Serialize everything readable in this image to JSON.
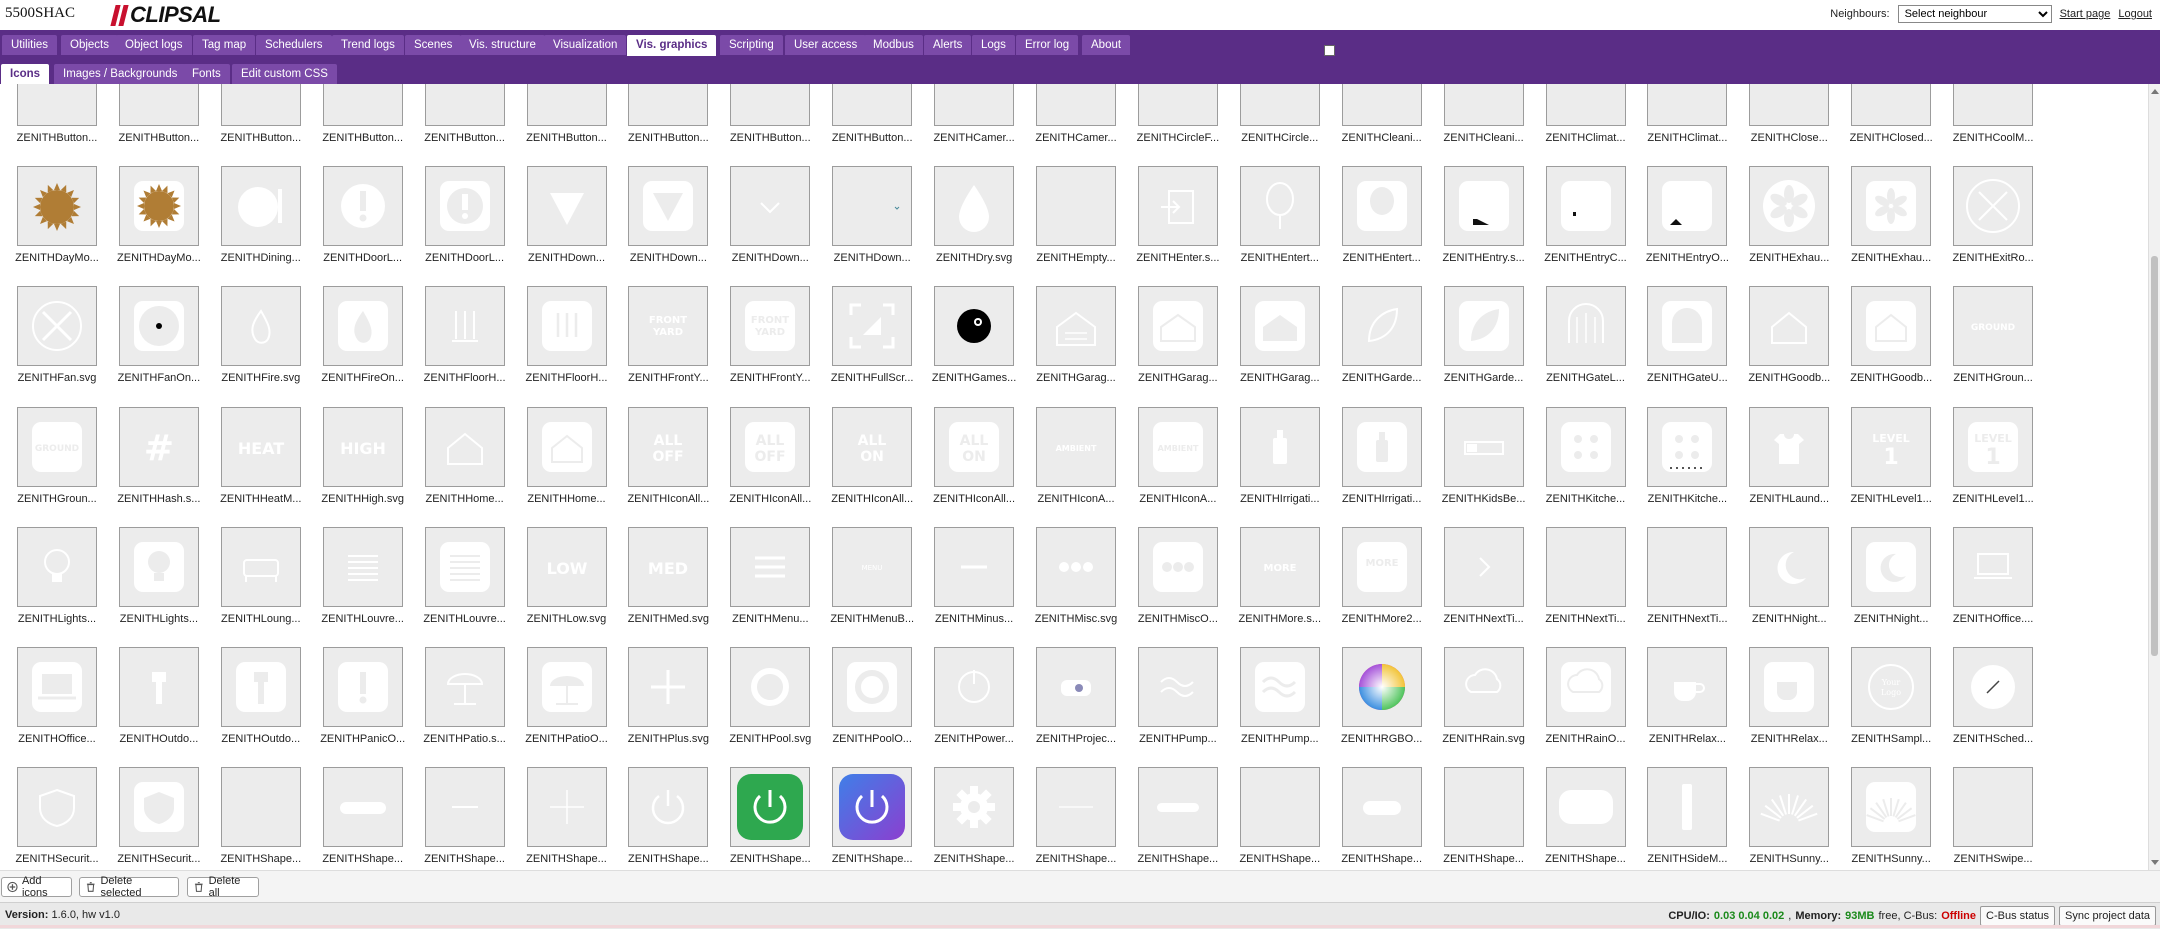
{
  "header": {
    "device_name": "5500SHAC",
    "logo_text": "CLIPSAL",
    "neighbours_label": "Neighbours:",
    "neighbour_select_value": "Select neighbour",
    "start_page_link": "Start page",
    "logout_link": "Logout"
  },
  "main_nav": [
    "Utilities",
    "Objects",
    "Object logs",
    "Tag map",
    "Schedulers",
    "Trend logs",
    "Scenes",
    "Vis. structure",
    "Visualization",
    "Vis. graphics",
    "Scripting",
    "User access",
    "Modbus",
    "Alerts",
    "Logs",
    "Error log",
    "About"
  ],
  "main_nav_active": "Vis. graphics",
  "sub_nav": [
    "Icons",
    "Images / Backgrounds",
    "Fonts",
    "Edit custom CSS"
  ],
  "sub_nav_active": "Icons",
  "icons": [
    {
      "label": "ZENITHButton...",
      "icon": "blank"
    },
    {
      "label": "ZENITHButton...",
      "icon": "green-toggle-partial"
    },
    {
      "label": "ZENITHButton...",
      "icon": "blank"
    },
    {
      "label": "ZENITHButton...",
      "icon": "blank"
    },
    {
      "label": "ZENITHButton...",
      "icon": "blank"
    },
    {
      "label": "ZENITHButton...",
      "icon": "blank"
    },
    {
      "label": "ZENITHButton...",
      "icon": "blank"
    },
    {
      "label": "ZENITHButton...",
      "icon": "blank"
    },
    {
      "label": "ZENITHButton...",
      "icon": "blank"
    },
    {
      "label": "ZENITHCamer...",
      "icon": "camera-dot"
    },
    {
      "label": "ZENITHCamer...",
      "icon": "camera-dot"
    },
    {
      "label": "ZENITHCircleF...",
      "icon": "circle-filled"
    },
    {
      "label": "ZENITHCircle...",
      "icon": "circle-outline"
    },
    {
      "label": "ZENITHCleani...",
      "icon": "cleaning-blue"
    },
    {
      "label": "ZENITHCleani...",
      "icon": "cleaning-blue-tile"
    },
    {
      "label": "ZENITHClimat...",
      "icon": "climate"
    },
    {
      "label": "ZENITHClimat...",
      "icon": "climate-tile"
    },
    {
      "label": "ZENITHClose...",
      "icon": "faint-text"
    },
    {
      "label": "ZENITHClosed...",
      "icon": "faint-text"
    },
    {
      "label": "ZENITHCoolM...",
      "icon": "faint-text"
    },
    {
      "label": "ZENITHDayMo...",
      "icon": "sun-brown"
    },
    {
      "label": "ZENITHDayMo...",
      "icon": "sun-brown-tile"
    },
    {
      "label": "ZENITHDining...",
      "icon": "dining"
    },
    {
      "label": "ZENITHDoorL...",
      "icon": "exclaim-circle"
    },
    {
      "label": "ZENITHDoorL...",
      "icon": "exclaim-circle-tile"
    },
    {
      "label": "ZENITHDown...",
      "icon": "down-triangle"
    },
    {
      "label": "ZENITHDown...",
      "icon": "down-triangle-tile"
    },
    {
      "label": "ZENITHDown...",
      "icon": "chevron-down"
    },
    {
      "label": "ZENITHDown...",
      "icon": "chevron-down-small"
    },
    {
      "label": "ZENITHDry.svg",
      "icon": "dry"
    },
    {
      "label": "ZENITHEmpty...",
      "icon": "blank"
    },
    {
      "label": "ZENITHEnter.s...",
      "icon": "enter"
    },
    {
      "label": "ZENITHEntert...",
      "icon": "balloon"
    },
    {
      "label": "ZENITHEntert...",
      "icon": "balloon-tile"
    },
    {
      "label": "ZENITHEntry.s...",
      "icon": "door-black"
    },
    {
      "label": "ZENITHEntryC...",
      "icon": "door-closed"
    },
    {
      "label": "ZENITHEntryO...",
      "icon": "door-open"
    },
    {
      "label": "ZENITHExhau...",
      "icon": "fan-exhaust"
    },
    {
      "label": "ZENITHExhau...",
      "icon": "fan-exhaust-tile"
    },
    {
      "label": "ZENITHExitRo...",
      "icon": "exit-x"
    },
    {
      "label": "ZENITHFan.svg",
      "icon": "fan"
    },
    {
      "label": "ZENITHFanOn...",
      "icon": "fan-on"
    },
    {
      "label": "ZENITHFire.svg",
      "icon": "fire"
    },
    {
      "label": "ZENITHFireOn...",
      "icon": "fire-tile"
    },
    {
      "label": "ZENITHFloorH...",
      "icon": "floor-heat"
    },
    {
      "label": "ZENITHFloorH...",
      "icon": "floor-heat-tile"
    },
    {
      "label": "ZENITHFrontY...",
      "icon": "front-yard"
    },
    {
      "label": "ZENITHFrontY...",
      "icon": "front-yard-tile"
    },
    {
      "label": "ZENITHFullScr...",
      "icon": "fullscreen"
    },
    {
      "label": "ZENITHGames...",
      "icon": "games-black"
    },
    {
      "label": "ZENITHGarag...",
      "icon": "garage"
    },
    {
      "label": "ZENITHGarag...",
      "icon": "garage-tile"
    },
    {
      "label": "ZENITHGarag...",
      "icon": "garage-house"
    },
    {
      "label": "ZENITHGarde...",
      "icon": "leaf"
    },
    {
      "label": "ZENITHGarde...",
      "icon": "leaf-tile"
    },
    {
      "label": "ZENITHGateL...",
      "icon": "gate"
    },
    {
      "label": "ZENITHGateU...",
      "icon": "gate-tile"
    },
    {
      "label": "ZENITHGoodb...",
      "icon": "house-out"
    },
    {
      "label": "ZENITHGoodb...",
      "icon": "house-out-tile"
    },
    {
      "label": "ZENITHGroun...",
      "icon": "ground"
    },
    {
      "label": "ZENITHGroun...",
      "icon": "ground-tile"
    },
    {
      "label": "ZENITHHash.s...",
      "icon": "hash"
    },
    {
      "label": "ZENITHHeatM...",
      "icon": "heat"
    },
    {
      "label": "ZENITHHigh.svg",
      "icon": "high"
    },
    {
      "label": "ZENITHHome...",
      "icon": "home"
    },
    {
      "label": "ZENITHHome...",
      "icon": "home-tile"
    },
    {
      "label": "ZENITHIconAll...",
      "icon": "all-off"
    },
    {
      "label": "ZENITHIconAll...",
      "icon": "all-off-tile"
    },
    {
      "label": "ZENITHIconAll...",
      "icon": "all-on"
    },
    {
      "label": "ZENITHIconAll...",
      "icon": "all-on-tile"
    },
    {
      "label": "ZENITHIconA...",
      "icon": "ambient"
    },
    {
      "label": "ZENITHIconA...",
      "icon": "ambient-tile"
    },
    {
      "label": "ZENITHIrrigati...",
      "icon": "irrigation"
    },
    {
      "label": "ZENITHIrrigati...",
      "icon": "irrigation-tile"
    },
    {
      "label": "ZENITHKidsBe...",
      "icon": "kids-bed"
    },
    {
      "label": "ZENITHKitche...",
      "icon": "kitchen"
    },
    {
      "label": "ZENITHKitche...",
      "icon": "kitchen-tile"
    },
    {
      "label": "ZENITHLaund...",
      "icon": "laundry"
    },
    {
      "label": "ZENITHLevel1...",
      "icon": "level1"
    },
    {
      "label": "ZENITHLevel1...",
      "icon": "level1-tile"
    },
    {
      "label": "ZENITHLights...",
      "icon": "bulb"
    },
    {
      "label": "ZENITHLights...",
      "icon": "bulb-tile"
    },
    {
      "label": "ZENITHLoung...",
      "icon": "sofa"
    },
    {
      "label": "ZENITHLouvre...",
      "icon": "louvre"
    },
    {
      "label": "ZENITHLouvre...",
      "icon": "louvre-tile"
    },
    {
      "label": "ZENITHLow.svg",
      "icon": "low"
    },
    {
      "label": "ZENITHMed.svg",
      "icon": "med"
    },
    {
      "label": "ZENITHMenu...",
      "icon": "menu"
    },
    {
      "label": "ZENITHMenuB...",
      "icon": "menu-bar"
    },
    {
      "label": "ZENITHMinus...",
      "icon": "minus"
    },
    {
      "label": "ZENITHMisc.svg",
      "icon": "misc"
    },
    {
      "label": "ZENITHMiscO...",
      "icon": "misc-tile"
    },
    {
      "label": "ZENITHMore.s...",
      "icon": "more"
    },
    {
      "label": "ZENITHMore2...",
      "icon": "more2"
    },
    {
      "label": "ZENITHNextTi...",
      "icon": "next"
    },
    {
      "label": "ZENITHNextTi...",
      "icon": "blank"
    },
    {
      "label": "ZENITHNextTi...",
      "icon": "blank"
    },
    {
      "label": "ZENITHNight...",
      "icon": "moon"
    },
    {
      "label": "ZENITHNight...",
      "icon": "moon-tile"
    },
    {
      "label": "ZENITHOffice....",
      "icon": "office"
    },
    {
      "label": "ZENITHOffice...",
      "icon": "office-tile"
    },
    {
      "label": "ZENITHOutdo...",
      "icon": "outdoor"
    },
    {
      "label": "ZENITHOutdo...",
      "icon": "outdoor-tile"
    },
    {
      "label": "ZENITHPanicO...",
      "icon": "panic"
    },
    {
      "label": "ZENITHPatio.s...",
      "icon": "patio"
    },
    {
      "label": "ZENITHPatioO...",
      "icon": "patio-tile"
    },
    {
      "label": "ZENITHPlus.svg",
      "icon": "plus"
    },
    {
      "label": "ZENITHPool.svg",
      "icon": "pool"
    },
    {
      "label": "ZENITHPoolO...",
      "icon": "pool-tile"
    },
    {
      "label": "ZENITHPower...",
      "icon": "power-faint"
    },
    {
      "label": "ZENITHProjec...",
      "icon": "projector"
    },
    {
      "label": "ZENITHPump...",
      "icon": "pump"
    },
    {
      "label": "ZENITHPump...",
      "icon": "pump-tile"
    },
    {
      "label": "ZENITHRGBO...",
      "icon": "rgb"
    },
    {
      "label": "ZENITHRain.svg",
      "icon": "rain"
    },
    {
      "label": "ZENITHRainO...",
      "icon": "rain-tile"
    },
    {
      "label": "ZENITHRelax...",
      "icon": "cup"
    },
    {
      "label": "ZENITHRelax...",
      "icon": "cup-tile"
    },
    {
      "label": "ZENITHSampl...",
      "icon": "sample-logo"
    },
    {
      "label": "ZENITHSched...",
      "icon": "schedule"
    },
    {
      "label": "ZENITHSecurit...",
      "icon": "shield"
    },
    {
      "label": "ZENITHSecurit...",
      "icon": "shield-tile"
    },
    {
      "label": "ZENITHShape...",
      "icon": "blank"
    },
    {
      "label": "ZENITHShape...",
      "icon": "pill"
    },
    {
      "label": "ZENITHShape...",
      "icon": "line"
    },
    {
      "label": "ZENITHShape...",
      "icon": "plus-faint"
    },
    {
      "label": "ZENITHShape...",
      "icon": "power-outline"
    },
    {
      "label": "ZENITHShape...",
      "icon": "power-green"
    },
    {
      "label": "ZENITHShape...",
      "icon": "power-blue"
    },
    {
      "label": "ZENITHShape...",
      "icon": "gear"
    },
    {
      "label": "ZENITHShape...",
      "icon": "line-faint"
    },
    {
      "label": "ZENITHShape...",
      "icon": "pill-small"
    },
    {
      "label": "ZENITHShape...",
      "icon": "blank"
    },
    {
      "label": "ZENITHShape...",
      "icon": "pill-round"
    },
    {
      "label": "ZENITHShape...",
      "icon": "blank"
    },
    {
      "label": "ZENITHShape...",
      "icon": "rounded-rect"
    },
    {
      "label": "ZENITHSideM...",
      "icon": "side-menu"
    },
    {
      "label": "ZENITHSunny...",
      "icon": "sunrise"
    },
    {
      "label": "ZENITHSunny...",
      "icon": "sunrise-tile"
    },
    {
      "label": "ZENITHSwipe...",
      "icon": "blank"
    }
  ],
  "toolbar": {
    "add_icons": "Add icons",
    "delete_selected": "Delete selected",
    "delete_all": "Delete all"
  },
  "status": {
    "version_label": "Version:",
    "version_value": "1.6.0, hw v1.0",
    "cpu_label": "CPU/IO:",
    "cpu_value": "0.03 0.04 0.02",
    "memory_label": "Memory:",
    "memory_value": "93MB",
    "memory_suffix": "free, C-Bus:",
    "cbus_state": "Offline",
    "cbus_status_button": "C-Bus status",
    "sync_button": "Sync project data"
  },
  "colors": {
    "nav_background": "#5a2d86",
    "tab_background": "#7b4aa8",
    "green_power": "#2ea84f",
    "blue_power": "#5a4fd6",
    "sun_brown": "#b07d35",
    "offline_red": "#cc0000",
    "ok_green": "#1b8a1b"
  }
}
